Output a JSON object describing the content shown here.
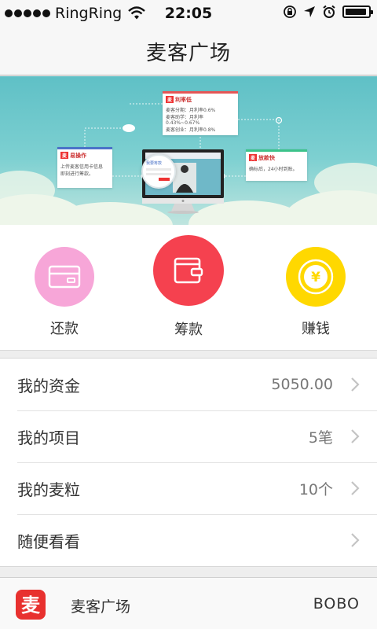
{
  "status_bar": {
    "carrier": "RingRing",
    "time": "22:05",
    "battery_level": 0.92
  },
  "nav": {
    "title": "麦客广场"
  },
  "banner": {
    "card_left": {
      "tag": "麦",
      "title": "易操作",
      "line1": "上传麦客信用卡信息",
      "line2": "即刻进行筹款。"
    },
    "card_top": {
      "tag": "麦",
      "title": "利率低",
      "line1": "麦客分期：月利率0.6%",
      "line2": "麦客助学：月利率0.43%~0.67%",
      "line3": "麦客创业：月利率0.8%"
    },
    "card_right": {
      "tag": "麦",
      "title": "放款快",
      "line1": "确标后，24小时到账。"
    },
    "screen_label": "我要筹款"
  },
  "actions": [
    {
      "label": "还款",
      "icon": "card-icon",
      "color": "#f7a6d8"
    },
    {
      "label": "筹款",
      "icon": "wallet-icon",
      "color": "#f5414f"
    },
    {
      "label": "赚钱",
      "icon": "yuan-coin-icon",
      "color": "#ffd800"
    }
  ],
  "list": [
    {
      "name": "我的资金",
      "value": "5050.00"
    },
    {
      "name": "我的项目",
      "value": "5笔"
    },
    {
      "name": "我的麦粒",
      "value": "10个"
    },
    {
      "name": "随便看看",
      "value": ""
    }
  ],
  "tab_bar": {
    "logo_char": "麦",
    "name": "麦客广场",
    "user": "BOBO",
    "brand_color": "#e8312f"
  }
}
